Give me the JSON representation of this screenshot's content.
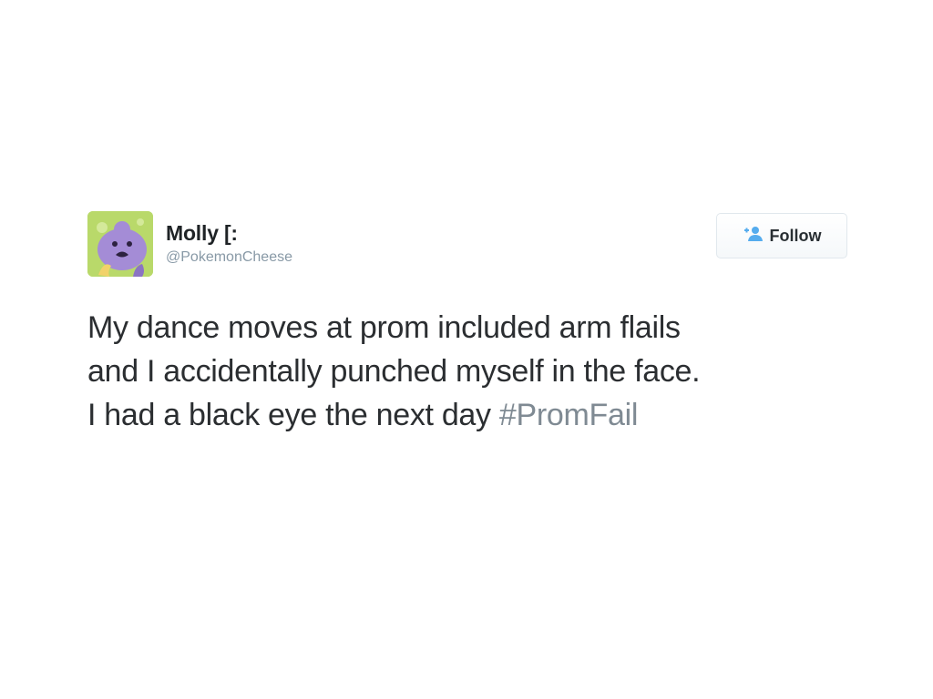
{
  "tweet": {
    "avatar_icon": "purple-blob-character-avatar-icon",
    "display_name": "Molly [:",
    "handle": "@PokemonCheese",
    "follow_button": {
      "icon": "add-user-icon",
      "label": "Follow"
    },
    "text_lines": [
      "My dance moves at prom included arm flails",
      "and I accidentally punched myself in the face.",
      "I had a black eye the next day "
    ],
    "hashtag": "#PromFail",
    "colors": {
      "name": "#1f2326",
      "handle": "#8899a6",
      "text": "#2b2e31",
      "hashtag": "#7f8a93",
      "button_border": "#e1e8ed",
      "avatar_bg": "#b9d96a",
      "avatar_character": "#a48cd6"
    }
  }
}
